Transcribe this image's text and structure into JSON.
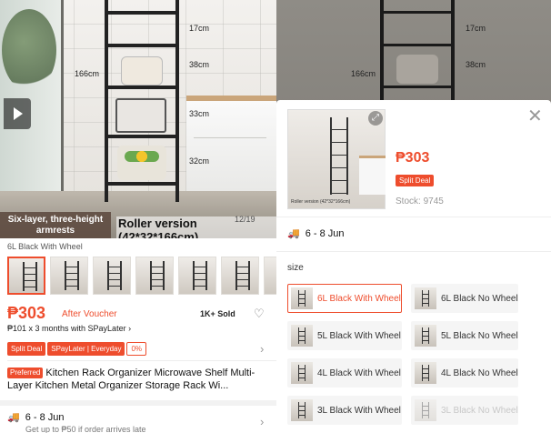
{
  "left": {
    "hero": {
      "tag": "Six-layer, three-height armrests",
      "caption": "Roller version (42*32*166cm)",
      "counter": "12/19",
      "dims": [
        "166cm",
        "17cm",
        "38cm",
        "33cm",
        "32cm"
      ]
    },
    "variant_label": "6L Black With Wheel",
    "price": "₱303",
    "after_voucher": "After Voucher",
    "sold": "1K+ Sold",
    "installment": "₱101 x 3 months with SPayLater ›",
    "badges": {
      "split": "Split Deal",
      "spaylater": "SPayLater | Everyday",
      "zero": "0%"
    },
    "preferred": "Preferred",
    "title": "Kitchen Rack Organizer Microwave Shelf Multi-Layer Kitchen Metal Organizer Storage Rack Wi...",
    "shipping": {
      "dates": "6 - 8 Jun",
      "sub": "Get up to ₱50 if order arrives late"
    }
  },
  "right": {
    "bg_dims": [
      "17cm",
      "38cm",
      "166cm"
    ],
    "sheet": {
      "image_caption": "Roller version (42*32*166cm)",
      "price": "₱303",
      "split": "Split Deal",
      "stock": "Stock: 9745",
      "shipping": "6 - 8 Jun",
      "size_label": "size",
      "options": [
        {
          "label": "6L Black With Wheel",
          "state": "selected"
        },
        {
          "label": "6L Black No Wheel",
          "state": "normal"
        },
        {
          "label": "5L Black With Wheel",
          "state": "normal"
        },
        {
          "label": "5L Black No Wheel",
          "state": "normal"
        },
        {
          "label": "4L Black With Wheel",
          "state": "normal"
        },
        {
          "label": "4L Black No Wheel",
          "state": "normal"
        },
        {
          "label": "3L Black With Wheel",
          "state": "normal"
        },
        {
          "label": "3L Black No Wheel",
          "state": "disabled"
        }
      ]
    }
  },
  "colors": {
    "accent": "#ee4d2d",
    "ship": "#26aa99"
  }
}
